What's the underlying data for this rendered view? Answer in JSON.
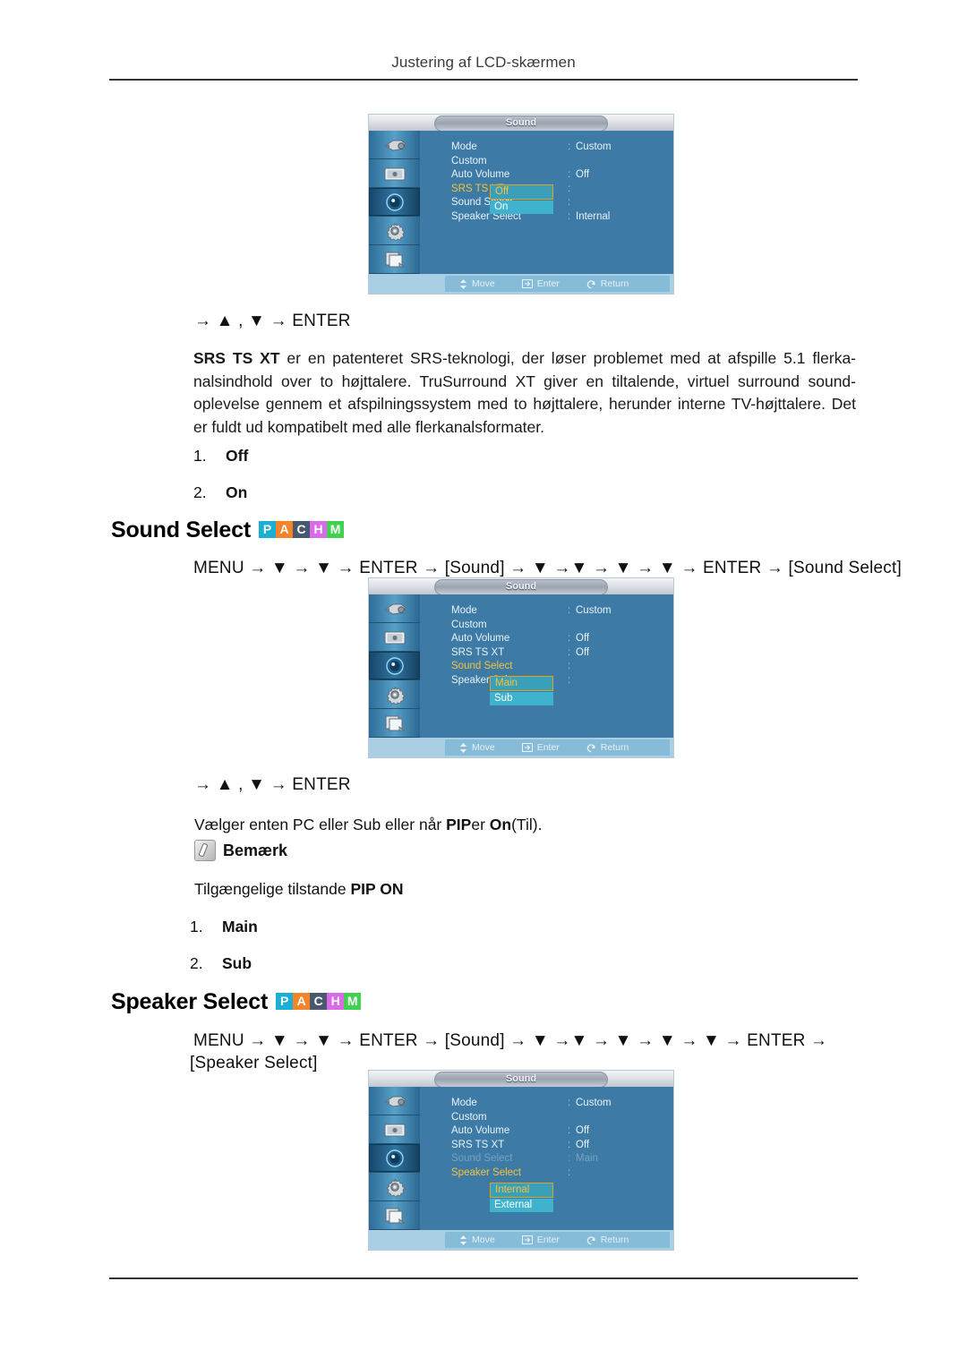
{
  "page": {
    "header_title": "Justering af LCD-skærmen"
  },
  "section_srs": {
    "nav_after": "→ ▲ , ▼ → ENTER",
    "paragraph_bold": "SRS TS XT",
    "paragraph_rest": " er en patenteret SRS-teknologi, der løser problemet med at afspille 5.1 flerka-nalsindhold over to højttalere. TruSurround XT giver en tiltalende, virtuel surround sound-oplevelse gennem et afspilningssystem med to højttalere, herunder interne TV-højttalere. Det er fuldt ud kompatibelt med alle flerkanalsformater.",
    "options": [
      {
        "index": "1.",
        "label": "Off"
      },
      {
        "index": "2.",
        "label": "On"
      }
    ]
  },
  "section_sound_select": {
    "title": "Sound Select",
    "badges": [
      {
        "letter": "P",
        "color": "#1bafd6"
      },
      {
        "letter": "A",
        "color": "#f5832a"
      },
      {
        "letter": "C",
        "color": "#48586f"
      },
      {
        "letter": "H",
        "color": "#d96ae8"
      },
      {
        "letter": "M",
        "color": "#3fd14f"
      }
    ],
    "nav_path": "MENU → ▼ → ▼ → ENTER → [Sound] → ▼ →▼ → ▼ → ▼ → ENTER → [Sound Select]",
    "nav_after": "→ ▲ , ▼ → ENTER",
    "desc_plain_1": "Vælger enten PC eller Sub eller når ",
    "desc_bold_1": "PIP",
    "desc_plain_2": "er ",
    "desc_bold_2": "On",
    "desc_plain_3": "(Til).",
    "note_label": "Bemærk",
    "note_text_plain": "Tilgængelige tilstande ",
    "note_text_bold": "PIP ON",
    "options": [
      {
        "index": "1.",
        "label": "Main"
      },
      {
        "index": "2.",
        "label": "Sub"
      }
    ]
  },
  "section_speaker_select": {
    "title": "Speaker Select",
    "badges": [
      {
        "letter": "P",
        "color": "#1bafd6"
      },
      {
        "letter": "A",
        "color": "#f5832a"
      },
      {
        "letter": "C",
        "color": "#48586f"
      },
      {
        "letter": "H",
        "color": "#d96ae8"
      },
      {
        "letter": "M",
        "color": "#3fd14f"
      }
    ],
    "nav_path_line1": "MENU → ▼ → ▼ → ENTER → [Sound] → ▼ →▼ → ▼ → ▼ → ▼ → ENTER →",
    "nav_path_line2": "[Speaker Select]"
  },
  "osd_common": {
    "title": "Sound",
    "footer": [
      {
        "icon": "move-icon",
        "label": "Move"
      },
      {
        "icon": "enter-icon",
        "label": "Enter"
      },
      {
        "icon": "return-icon",
        "label": "Return"
      }
    ],
    "rail_icons": [
      "input-source-icon",
      "picture-icon",
      "sound-icon",
      "setup-gear-icon",
      "multi-control-icon"
    ],
    "colon": ":"
  },
  "osd1": {
    "rows": [
      {
        "label": "Mode",
        "value": "Custom"
      },
      {
        "label": "Custom",
        "value": ""
      },
      {
        "label": "Auto Volume",
        "value": "Off"
      },
      {
        "label": "SRS TS XT",
        "value": ""
      },
      {
        "label": "Sound Select",
        "value": ""
      },
      {
        "label": "Speaker Select",
        "value": "Internal"
      }
    ],
    "highlight_row": "SRS TS XT",
    "dropdown": {
      "current": "Off",
      "other": "On"
    }
  },
  "osd2": {
    "rows": [
      {
        "label": "Mode",
        "value": "Custom"
      },
      {
        "label": "Custom",
        "value": ""
      },
      {
        "label": "Auto Volume",
        "value": "Off"
      },
      {
        "label": "SRS TS XT",
        "value": "Off"
      },
      {
        "label": "Sound Select",
        "value": ""
      },
      {
        "label": "Speaker Select",
        "value": ""
      }
    ],
    "highlight_row": "Sound Select",
    "dropdown": {
      "current": "Main",
      "other": "Sub"
    }
  },
  "osd3": {
    "rows": [
      {
        "label": "Mode",
        "value": "Custom"
      },
      {
        "label": "Custom",
        "value": ""
      },
      {
        "label": "Auto Volume",
        "value": "Off"
      },
      {
        "label": "SRS TS XT",
        "value": "Off"
      },
      {
        "label": "Sound Select",
        "value": "Main"
      },
      {
        "label": "Speaker Select",
        "value": ""
      }
    ],
    "highlight_row": "Speaker Select",
    "dimmed_row": "Sound Select",
    "dropdown": {
      "current": "Internal",
      "other": "External"
    }
  }
}
